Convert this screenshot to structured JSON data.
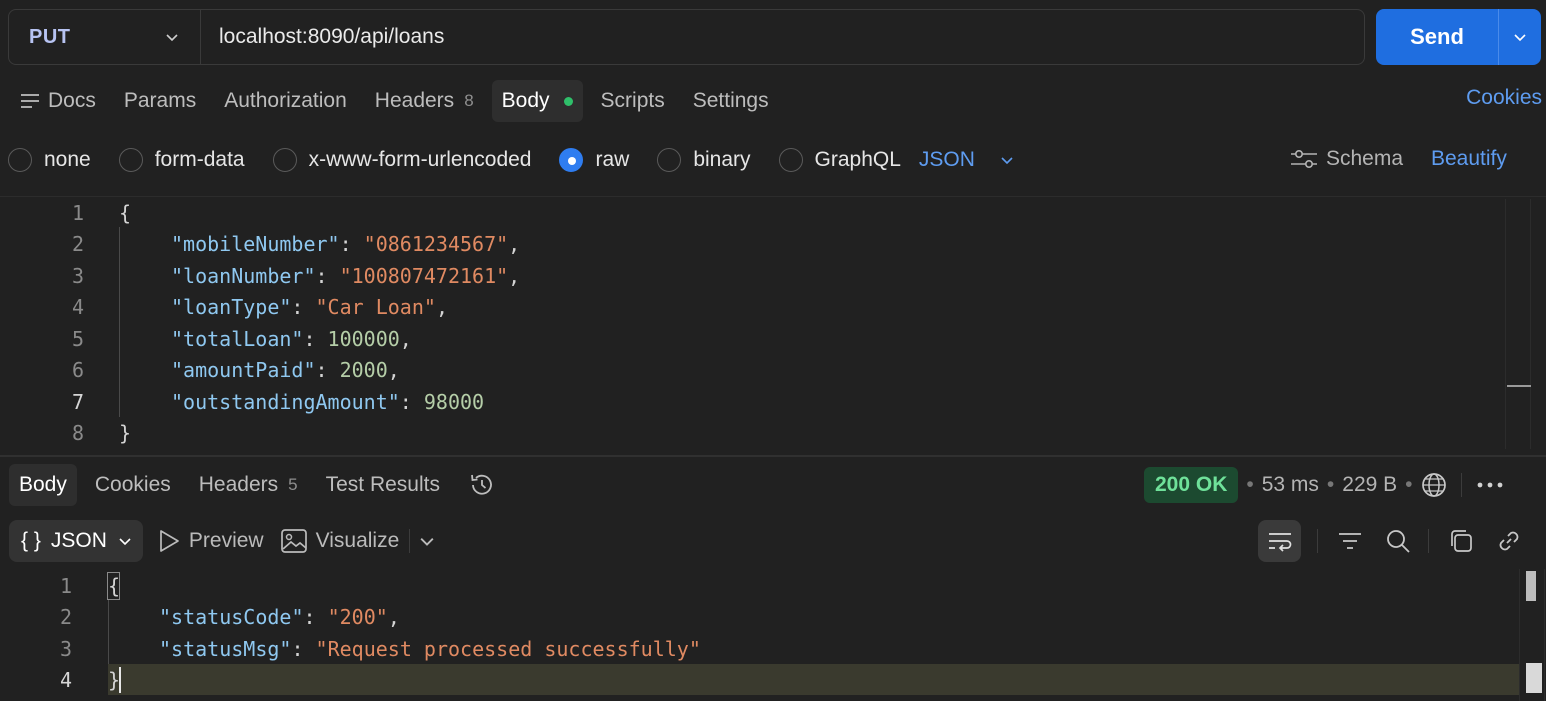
{
  "request": {
    "method": "PUT",
    "url": "localhost:8090/api/loans",
    "send_label": "Send"
  },
  "request_tabs": [
    {
      "label": "Docs"
    },
    {
      "label": "Params"
    },
    {
      "label": "Authorization"
    },
    {
      "label": "Headers",
      "count": "8"
    },
    {
      "label": "Body",
      "active": true
    },
    {
      "label": "Scripts"
    },
    {
      "label": "Settings"
    }
  ],
  "cookies_link": "Cookies",
  "body_types": {
    "options": [
      "none",
      "form-data",
      "x-www-form-urlencoded",
      "raw",
      "binary",
      "GraphQL"
    ],
    "selected": "raw",
    "format": "JSON",
    "schema_label": "Schema",
    "beautify_label": "Beautify"
  },
  "request_body": {
    "line_numbers": [
      "1",
      "2",
      "3",
      "4",
      "5",
      "6",
      "7",
      "8"
    ],
    "open_brace": "{",
    "close_brace": "}",
    "fields": [
      {
        "key": "\"mobileNumber\"",
        "value": "\"0861234567\"",
        "type": "string",
        "comma": ","
      },
      {
        "key": "\"loanNumber\"",
        "value": "\"100807472161\"",
        "type": "string",
        "comma": ","
      },
      {
        "key": "\"loanType\"",
        "value": "\"Car Loan\"",
        "type": "string",
        "comma": ","
      },
      {
        "key": "\"totalLoan\"",
        "value": "100000",
        "type": "number",
        "comma": ","
      },
      {
        "key": "\"amountPaid\"",
        "value": "2000",
        "type": "number",
        "comma": ","
      },
      {
        "key": "\"outstandingAmount\"",
        "value": "98000",
        "type": "number",
        "comma": ""
      }
    ]
  },
  "response_tabs": [
    {
      "label": "Body",
      "active": true
    },
    {
      "label": "Cookies"
    },
    {
      "label": "Headers",
      "count": "5"
    },
    {
      "label": "Test Results"
    }
  ],
  "response_status": {
    "code": "200 OK",
    "time": "53 ms",
    "size": "229 B"
  },
  "response_toolbar": {
    "format": "JSON",
    "brace_icon": "{ }",
    "preview": "Preview",
    "visualize": "Visualize"
  },
  "response_body": {
    "line_numbers": [
      "1",
      "2",
      "3",
      "4"
    ],
    "open_brace": "{",
    "close_brace": "}",
    "fields": [
      {
        "key": "\"statusCode\"",
        "value": "\"200\"",
        "comma": ","
      },
      {
        "key": "\"statusMsg\"",
        "value": "\"Request processed successfully\"",
        "comma": ""
      }
    ]
  },
  "colors": {
    "accent": "#1f6ee0",
    "link": "#5e9cf0",
    "json_key": "#8fc8f0",
    "json_string": "#e08a62",
    "json_number": "#b5cea8",
    "status_ok_bg": "#1c4a30",
    "status_ok_text": "#6fe19a"
  }
}
